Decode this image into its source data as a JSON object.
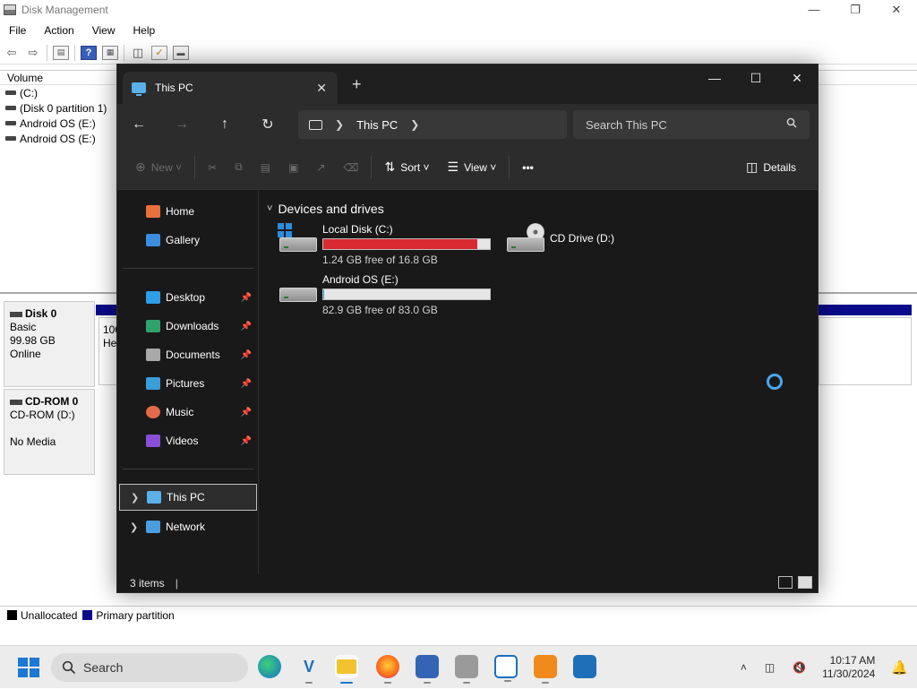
{
  "disk_management": {
    "title": "Disk Management",
    "window_controls": [
      "—",
      "❐",
      "✕"
    ],
    "menu": [
      "File",
      "Action",
      "View",
      "Help"
    ],
    "volume_list": {
      "header": "Volume",
      "rows": [
        "(C:)",
        "(Disk 0 partition 1)",
        "Android OS (E:)",
        "Android OS (E:)"
      ]
    },
    "disks": [
      {
        "name": "Disk 0",
        "type": "Basic",
        "size": "99.98 GB",
        "status": "Online",
        "partition_fragment_1": "100",
        "partition_fragment_2": "He"
      },
      {
        "name": "CD-ROM 0",
        "type": "CD-ROM (D:)",
        "status": "No Media"
      }
    ],
    "legend": [
      {
        "label": "Unallocated",
        "color": "#000000"
      },
      {
        "label": "Primary partition",
        "color": "#0a0a8a"
      }
    ]
  },
  "explorer": {
    "tab_title": "This PC",
    "new_tab": "+",
    "window_controls": [
      "—",
      "☐",
      "✕"
    ],
    "breadcrumb": [
      "This PC"
    ],
    "search_placeholder": "Search This PC",
    "commands": {
      "new": "New",
      "sort": "Sort",
      "view": "View",
      "more": "•••",
      "details": "Details"
    },
    "nav": {
      "top": [
        "Home",
        "Gallery"
      ],
      "pinned": [
        "Desktop",
        "Downloads",
        "Documents",
        "Pictures",
        "Music",
        "Videos"
      ],
      "tree": [
        "This PC",
        "Network"
      ]
    },
    "group_header": "Devices and drives",
    "drives": [
      {
        "name": "Local Disk (C:)",
        "free_text": "1.24 GB free of 16.8 GB",
        "used_fraction": 0.926,
        "bar_color": "#da2b32"
      },
      {
        "name": "CD Drive (D:)"
      },
      {
        "name": "Android OS (E:)",
        "free_text": "82.9 GB free of 83.0 GB",
        "used_fraction": 0.001,
        "bar_color": "#26a0da"
      }
    ],
    "status": {
      "item_count": "3 items"
    }
  },
  "taskbar": {
    "search": "Search",
    "apps": [
      "edge",
      "vs-code-like",
      "file-explorer",
      "firefox",
      "remote-desktop",
      "disk-tool",
      "network-tool",
      "package-tool",
      "monitor-tool"
    ],
    "time": "10:17 AM",
    "date": "11/30/2024"
  }
}
